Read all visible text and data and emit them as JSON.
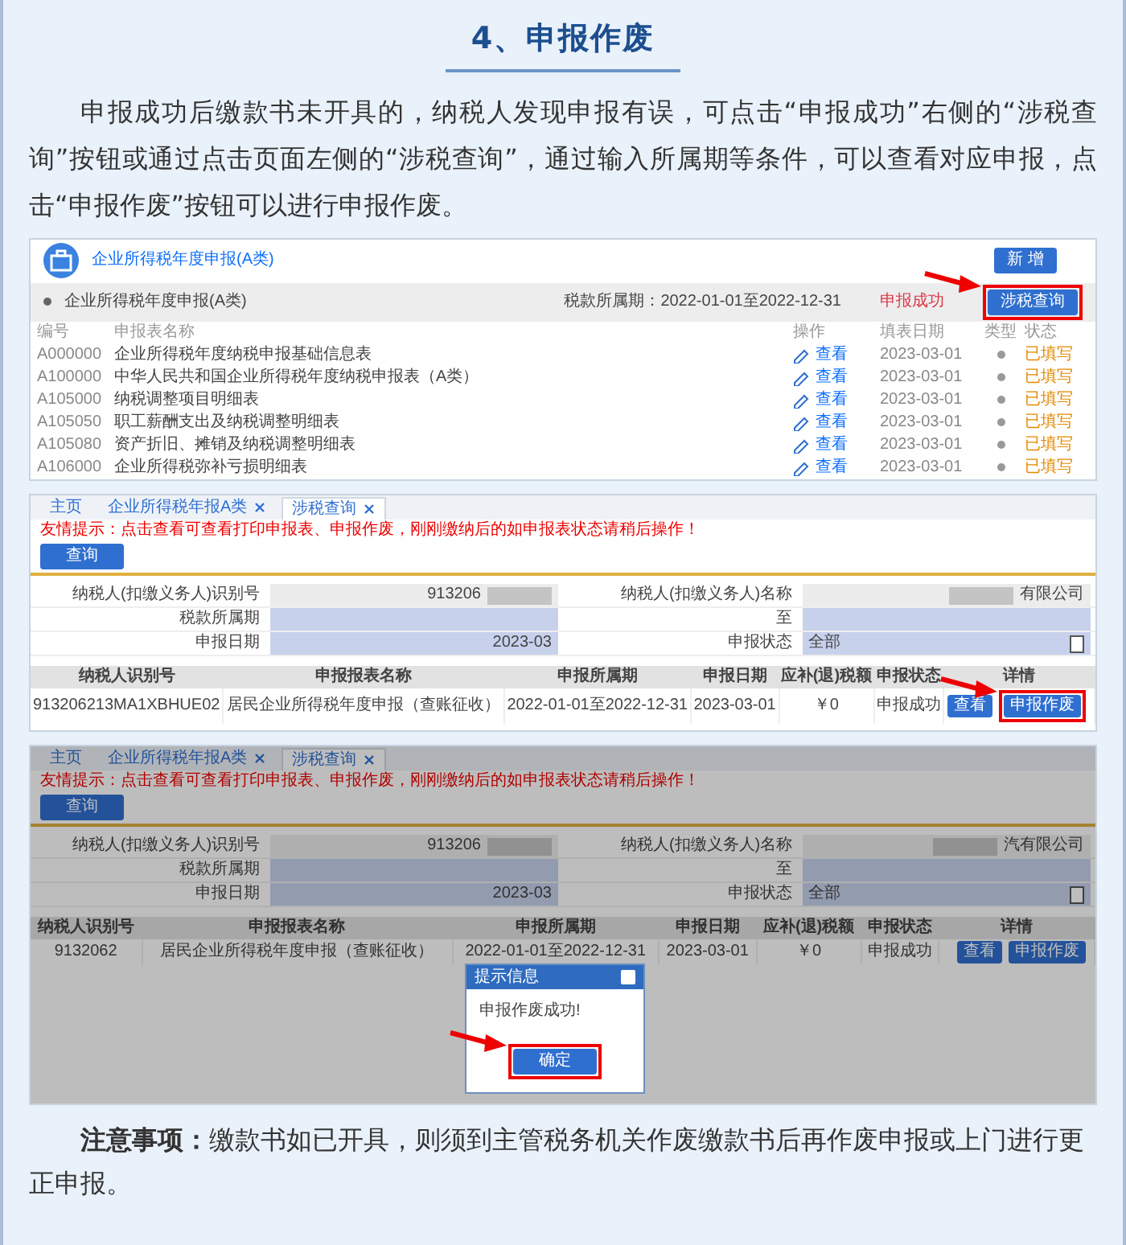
{
  "heading": "4、申报作废",
  "intro": "申报成功后缴款书未开具的，纳税人发现申报有误，可点击“申报成功”右侧的“涉税查询”按钮或通过点击页面左侧的“涉税查询”，通过输入所属期等条件，可以查看对应申报，点击“申报作废”按钮可以进行申报作废。",
  "screens": [
    {
      "kind": "declaration_list",
      "title": "企业所得税年度申报(A类)",
      "add_button": "新 增",
      "period_bar": {
        "name": "企业所得税年度申报(A类)",
        "period": "税款所属期：2022-01-01至2022-12-31",
        "status": "申报成功",
        "query_button": {
          "label": "涉税查询",
          "highlighted": true
        }
      },
      "columns": [
        "编号",
        "申报表名称",
        "操作",
        "填表日期",
        "类型",
        "状态"
      ],
      "rows": [
        {
          "code": "A000000",
          "name": "企业所得税年度纳税申报基础信息表",
          "action": "查看",
          "date": "2023-03-01",
          "status": "已填写"
        },
        {
          "code": "A100000",
          "name": "中华人民共和国企业所得税年度纳税申报表（A类）",
          "action": "查看",
          "date": "2023-03-01",
          "status": "已填写"
        },
        {
          "code": "A105000",
          "name": "纳税调整项目明细表",
          "action": "查看",
          "date": "2023-03-01",
          "status": "已填写"
        },
        {
          "code": "A105050",
          "name": "职工薪酬支出及纳税调整明细表",
          "action": "查看",
          "date": "2023-03-01",
          "status": "已填写"
        },
        {
          "code": "A105080",
          "name": "资产折旧、摊销及纳税调整明细表",
          "action": "查看",
          "date": "2023-03-01",
          "status": "已填写"
        },
        {
          "code": "A106000",
          "name": "企业所得税弥补亏损明细表",
          "action": "查看",
          "date": "2023-03-01",
          "status": "已填写"
        }
      ]
    },
    {
      "kind": "query",
      "dimmed": false,
      "tabs": [
        {
          "label": "主页",
          "closable": false,
          "selected": false
        },
        {
          "label": "企业所得税年报A类",
          "closable": true,
          "selected": false
        },
        {
          "label": "涉税查询",
          "closable": true,
          "selected": true
        }
      ],
      "notice": "友情提示：点击查看可查看打印申报表、申报作废，刚刚缴纳后的如申报表状态请稍后操作！",
      "query_button": "查询",
      "form": [
        [
          {
            "label": "纳税人(扣缴义务人)识别号",
            "value": "913206",
            "redacted_end": true,
            "shaded": false
          },
          {
            "label": "纳税人(扣缴义务人)名称",
            "value": "有限公司",
            "redacted_start": true,
            "shaded": false
          }
        ],
        [
          {
            "label": "税款所属期",
            "shaded": true
          },
          {
            "label": "至",
            "shaded": true
          }
        ],
        [
          {
            "label": "申报日期",
            "value": "2023-03",
            "shaded": true
          },
          {
            "label": "申报状态",
            "value": "全部",
            "kind": "select",
            "shaded": true
          }
        ]
      ],
      "columns": [
        "纳税人识别号",
        "申报报表名称",
        "申报所属期",
        "申报日期",
        "应补(退)税额",
        "申报状态",
        "详情"
      ],
      "rows": [
        {
          "cells": [
            "913206213MA1XBHUE02",
            "居民企业所得税年度申报（查账征收）",
            "2022-01-01至2022-12-31",
            "2023-03-01",
            "￥0",
            "申报成功"
          ],
          "buttons": [
            {
              "label": "查看",
              "highlighted": false
            },
            {
              "label": "申报作废",
              "highlighted": true
            }
          ]
        }
      ]
    },
    {
      "kind": "query",
      "dimmed": true,
      "tabs": [
        {
          "label": "主页",
          "closable": false,
          "selected": false
        },
        {
          "label": "企业所得税年报A类",
          "closable": true,
          "selected": false
        },
        {
          "label": "涉税查询",
          "closable": true,
          "selected": true
        }
      ],
      "notice": "友情提示：点击查看可查看打印申报表、申报作废，刚刚缴纳后的如申报表状态请稍后操作！",
      "query_button": "查询",
      "form": [
        [
          {
            "label": "纳税人(扣缴义务人)识别号",
            "value": "913206",
            "redacted_end": true,
            "shaded": false
          },
          {
            "label": "纳税人(扣缴义务人)名称",
            "value": "汽有限公司",
            "redacted_start": true,
            "shaded": false
          }
        ],
        [
          {
            "label": "税款所属期",
            "shaded": true
          },
          {
            "label": "至",
            "shaded": true
          }
        ],
        [
          {
            "label": "申报日期",
            "value": "2023-03",
            "shaded": true
          },
          {
            "label": "申报状态",
            "value": "全部",
            "kind": "select",
            "shaded": true
          }
        ]
      ],
      "columns": [
        "纳税人识别号",
        "申报报表名称",
        "申报所属期",
        "申报日期",
        "应补(退)税额",
        "申报状态",
        "详情"
      ],
      "rows": [
        {
          "cells": [
            "9132062",
            "居民企业所得税年度申报（查账征收）",
            "2022-01-01至2022-12-31",
            "2023-03-01",
            "￥0",
            "申报成功"
          ],
          "buttons": [
            {
              "label": "查看",
              "highlighted": false
            },
            {
              "label": "申报作废",
              "highlighted": false
            }
          ]
        }
      ],
      "dialog": {
        "title": "提示信息",
        "message": "申报作废成功!",
        "button": {
          "label": "确定",
          "highlighted": true
        }
      }
    }
  ],
  "note": "**注意事项：**缴款书如已开具，则须到主管税务机关作废缴款书后再作废申报或上门进行更正申报。"
}
